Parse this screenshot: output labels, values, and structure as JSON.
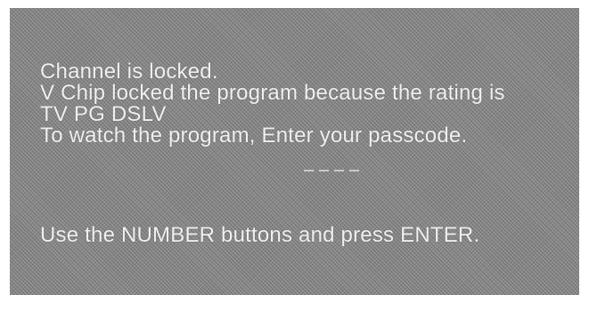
{
  "message": {
    "line1": "Channel is locked.",
    "line2": "V Chip locked the program because the rating is",
    "line3": "TV PG DSLV",
    "line4": "To watch the program, Enter your passcode.",
    "instruction": "Use the NUMBER buttons and press ENTER."
  },
  "passcode": {
    "digits_entered": 0,
    "digits_total": 4
  },
  "colors": {
    "screen_bg": "#8a8a8a",
    "text": "#f0f0f0"
  }
}
